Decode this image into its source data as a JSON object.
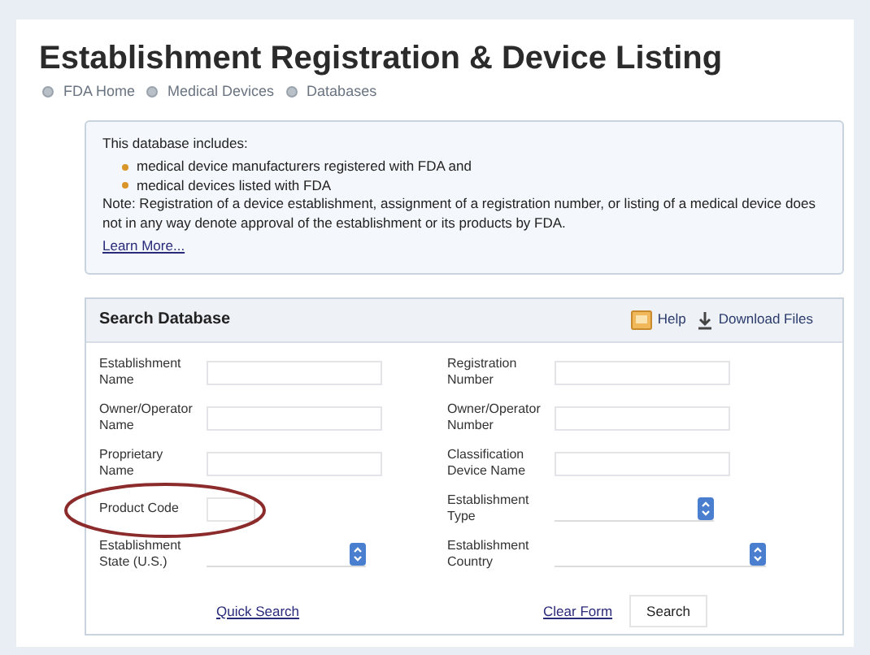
{
  "title": "Establishment Registration & Device Listing",
  "breadcrumbs": [
    "FDA Home",
    "Medical Devices",
    "Databases"
  ],
  "info": {
    "intro": "This database includes:",
    "bullets": [
      "medical device manufacturers registered with FDA and",
      "medical devices listed with FDA"
    ],
    "note": "Note: Registration of a device establishment, assignment of a registration number, or listing of a medical device does not in any way denote approval of the establishment or its products by FDA.",
    "link": "Learn More..."
  },
  "search": {
    "title": "Search Database",
    "actions": [
      {
        "kind": "help",
        "label": "Help"
      },
      {
        "kind": "download",
        "label": "Download Files"
      }
    ],
    "left_fields": [
      {
        "label": "Establishment Name",
        "kind": "text",
        "circled": false
      },
      {
        "label": "Owner/Operator Name",
        "kind": "text",
        "circled": false
      },
      {
        "label": "Proprietary Name",
        "kind": "text",
        "circled": false
      },
      {
        "label": "Product Code",
        "kind": "short",
        "circled": true
      },
      {
        "label": "Establishment State (U.S.)",
        "kind": "select",
        "circled": false
      }
    ],
    "right_fields": [
      {
        "label": "Registration Number",
        "kind": "text",
        "circled": false
      },
      {
        "label": "Owner/Operator Number",
        "kind": "text",
        "circled": false
      },
      {
        "label": "Classification Device Name",
        "kind": "text",
        "circled": false
      },
      {
        "label": "Establishment Type",
        "kind": "select",
        "circled": false
      },
      {
        "label": "Establishment Country",
        "kind": "select",
        "circled": false
      }
    ],
    "quick_search": "Quick Search",
    "clear_form": "Clear Form",
    "search_button": "Search"
  }
}
